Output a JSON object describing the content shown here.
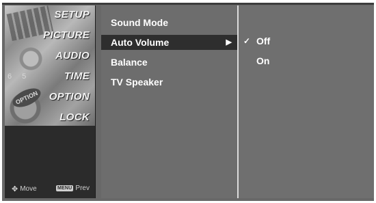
{
  "categories": [
    {
      "label": "SETUP"
    },
    {
      "label": "PICTURE"
    },
    {
      "label": "AUDIO"
    },
    {
      "label": "TIME"
    },
    {
      "label": "OPTION"
    },
    {
      "label": "LOCK"
    }
  ],
  "art": {
    "numbers": "6 5",
    "option_disc": "OPTION"
  },
  "hints": {
    "move_label": "Move",
    "menu_key": "MENU",
    "prev_label": "Prev"
  },
  "options": [
    {
      "label": "Sound Mode"
    },
    {
      "label": "Auto Volume"
    },
    {
      "label": "Balance"
    },
    {
      "label": "TV Speaker"
    }
  ],
  "selected_option_arrow": "▶",
  "values": [
    {
      "label": "Off",
      "checked": true,
      "check": "✓"
    },
    {
      "label": "On",
      "checked": false
    }
  ],
  "colors": {
    "frame": "#686868",
    "category_panel": "#2f2f2f",
    "selection": "#2e2e2e",
    "text": "#ffffff"
  }
}
